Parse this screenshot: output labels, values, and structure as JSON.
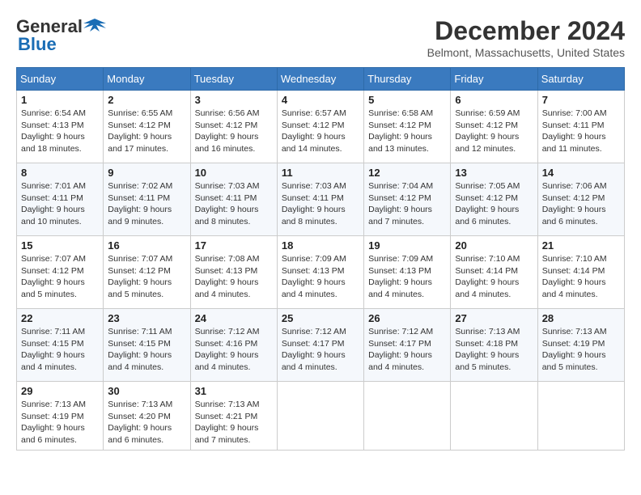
{
  "header": {
    "logo_general": "General",
    "logo_blue": "Blue",
    "month_title": "December 2024",
    "location": "Belmont, Massachusetts, United States"
  },
  "calendar": {
    "days_of_week": [
      "Sunday",
      "Monday",
      "Tuesday",
      "Wednesday",
      "Thursday",
      "Friday",
      "Saturday"
    ],
    "weeks": [
      [
        {
          "day": "1",
          "sunrise": "6:54 AM",
          "sunset": "4:13 PM",
          "daylight": "9 hours and 18 minutes."
        },
        {
          "day": "2",
          "sunrise": "6:55 AM",
          "sunset": "4:12 PM",
          "daylight": "9 hours and 17 minutes."
        },
        {
          "day": "3",
          "sunrise": "6:56 AM",
          "sunset": "4:12 PM",
          "daylight": "9 hours and 16 minutes."
        },
        {
          "day": "4",
          "sunrise": "6:57 AM",
          "sunset": "4:12 PM",
          "daylight": "9 hours and 14 minutes."
        },
        {
          "day": "5",
          "sunrise": "6:58 AM",
          "sunset": "4:12 PM",
          "daylight": "9 hours and 13 minutes."
        },
        {
          "day": "6",
          "sunrise": "6:59 AM",
          "sunset": "4:12 PM",
          "daylight": "9 hours and 12 minutes."
        },
        {
          "day": "7",
          "sunrise": "7:00 AM",
          "sunset": "4:11 PM",
          "daylight": "9 hours and 11 minutes."
        }
      ],
      [
        {
          "day": "8",
          "sunrise": "7:01 AM",
          "sunset": "4:11 PM",
          "daylight": "9 hours and 10 minutes."
        },
        {
          "day": "9",
          "sunrise": "7:02 AM",
          "sunset": "4:11 PM",
          "daylight": "9 hours and 9 minutes."
        },
        {
          "day": "10",
          "sunrise": "7:03 AM",
          "sunset": "4:11 PM",
          "daylight": "9 hours and 8 minutes."
        },
        {
          "day": "11",
          "sunrise": "7:03 AM",
          "sunset": "4:11 PM",
          "daylight": "9 hours and 8 minutes."
        },
        {
          "day": "12",
          "sunrise": "7:04 AM",
          "sunset": "4:12 PM",
          "daylight": "9 hours and 7 minutes."
        },
        {
          "day": "13",
          "sunrise": "7:05 AM",
          "sunset": "4:12 PM",
          "daylight": "9 hours and 6 minutes."
        },
        {
          "day": "14",
          "sunrise": "7:06 AM",
          "sunset": "4:12 PM",
          "daylight": "9 hours and 6 minutes."
        }
      ],
      [
        {
          "day": "15",
          "sunrise": "7:07 AM",
          "sunset": "4:12 PM",
          "daylight": "9 hours and 5 minutes."
        },
        {
          "day": "16",
          "sunrise": "7:07 AM",
          "sunset": "4:12 PM",
          "daylight": "9 hours and 5 minutes."
        },
        {
          "day": "17",
          "sunrise": "7:08 AM",
          "sunset": "4:13 PM",
          "daylight": "9 hours and 4 minutes."
        },
        {
          "day": "18",
          "sunrise": "7:09 AM",
          "sunset": "4:13 PM",
          "daylight": "9 hours and 4 minutes."
        },
        {
          "day": "19",
          "sunrise": "7:09 AM",
          "sunset": "4:13 PM",
          "daylight": "9 hours and 4 minutes."
        },
        {
          "day": "20",
          "sunrise": "7:10 AM",
          "sunset": "4:14 PM",
          "daylight": "9 hours and 4 minutes."
        },
        {
          "day": "21",
          "sunrise": "7:10 AM",
          "sunset": "4:14 PM",
          "daylight": "9 hours and 4 minutes."
        }
      ],
      [
        {
          "day": "22",
          "sunrise": "7:11 AM",
          "sunset": "4:15 PM",
          "daylight": "9 hours and 4 minutes."
        },
        {
          "day": "23",
          "sunrise": "7:11 AM",
          "sunset": "4:15 PM",
          "daylight": "9 hours and 4 minutes."
        },
        {
          "day": "24",
          "sunrise": "7:12 AM",
          "sunset": "4:16 PM",
          "daylight": "9 hours and 4 minutes."
        },
        {
          "day": "25",
          "sunrise": "7:12 AM",
          "sunset": "4:17 PM",
          "daylight": "9 hours and 4 minutes."
        },
        {
          "day": "26",
          "sunrise": "7:12 AM",
          "sunset": "4:17 PM",
          "daylight": "9 hours and 4 minutes."
        },
        {
          "day": "27",
          "sunrise": "7:13 AM",
          "sunset": "4:18 PM",
          "daylight": "9 hours and 5 minutes."
        },
        {
          "day": "28",
          "sunrise": "7:13 AM",
          "sunset": "4:19 PM",
          "daylight": "9 hours and 5 minutes."
        }
      ],
      [
        {
          "day": "29",
          "sunrise": "7:13 AM",
          "sunset": "4:19 PM",
          "daylight": "9 hours and 6 minutes."
        },
        {
          "day": "30",
          "sunrise": "7:13 AM",
          "sunset": "4:20 PM",
          "daylight": "9 hours and 6 minutes."
        },
        {
          "day": "31",
          "sunrise": "7:13 AM",
          "sunset": "4:21 PM",
          "daylight": "9 hours and 7 minutes."
        },
        null,
        null,
        null,
        null
      ]
    ]
  }
}
